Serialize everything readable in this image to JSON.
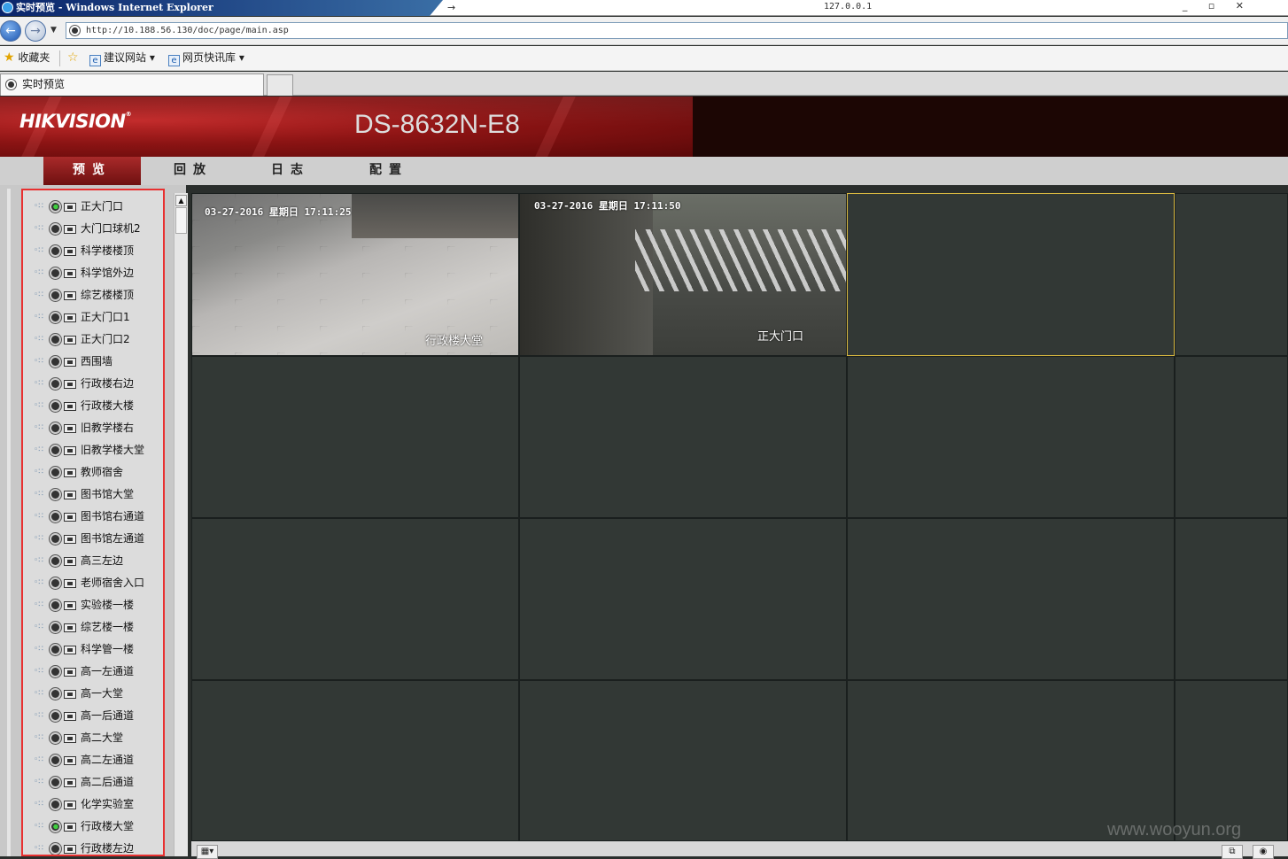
{
  "window": {
    "title": "实时预览 - Windows Internet Explorer",
    "address_hint": "127.0.0.1",
    "buttons": "_ ▫ ✕"
  },
  "browser": {
    "url": "http://10.188.56.130/doc/page/main.asp",
    "favorites_label": "收藏夹",
    "fav_links": [
      "建议网站 ▾",
      "网页快讯库 ▾"
    ],
    "tab_title": "实时预览"
  },
  "app": {
    "brand": "HIKVISION",
    "brand_tm": "®",
    "model": "DS-8632N-E8",
    "menu": [
      "预览",
      "回放",
      "日志",
      "配置"
    ],
    "active_menu": 0,
    "accent_color": "#e83030",
    "selected_cell_color": "#d8b840"
  },
  "cameras": [
    {
      "name": "正大门口",
      "live": true
    },
    {
      "name": "大门口球机2",
      "live": false
    },
    {
      "name": "科学楼楼顶",
      "live": false
    },
    {
      "name": "科学馆外边",
      "live": false
    },
    {
      "name": "综艺楼楼顶",
      "live": false
    },
    {
      "name": "正大门口1",
      "live": false
    },
    {
      "name": "正大门口2",
      "live": false
    },
    {
      "name": "西围墙",
      "live": false
    },
    {
      "name": "行政楼右边",
      "live": false
    },
    {
      "name": "行政楼大楼",
      "live": false
    },
    {
      "name": "旧教学楼右",
      "live": false
    },
    {
      "name": "旧教学楼大堂",
      "live": false
    },
    {
      "name": "教师宿舍",
      "live": false
    },
    {
      "name": "图书馆大堂",
      "live": false
    },
    {
      "name": "图书馆右通道",
      "live": false
    },
    {
      "name": "图书馆左通道",
      "live": false
    },
    {
      "name": "高三左边",
      "live": false
    },
    {
      "name": "老师宿舍入口",
      "live": false
    },
    {
      "name": "实验楼一楼",
      "live": false
    },
    {
      "name": "综艺楼一楼",
      "live": false
    },
    {
      "name": "科学管一楼",
      "live": false
    },
    {
      "name": "高一左通道",
      "live": false
    },
    {
      "name": "高一大堂",
      "live": false
    },
    {
      "name": "高一后通道",
      "live": false
    },
    {
      "name": "高二大堂",
      "live": false
    },
    {
      "name": "高二左通道",
      "live": false
    },
    {
      "name": "高二后通道",
      "live": false
    },
    {
      "name": "化学实验室",
      "live": false
    },
    {
      "name": "行政楼大堂",
      "live": true
    },
    {
      "name": "行政楼左边",
      "live": false
    }
  ],
  "feeds": [
    {
      "osd": "03-27-2016 星期日 17:11:25",
      "label": "行政楼大堂"
    },
    {
      "osd": "03-27-2016 星期日 17:11:50",
      "label": "正大门口"
    }
  ],
  "watermark": "www.wooyun.org"
}
